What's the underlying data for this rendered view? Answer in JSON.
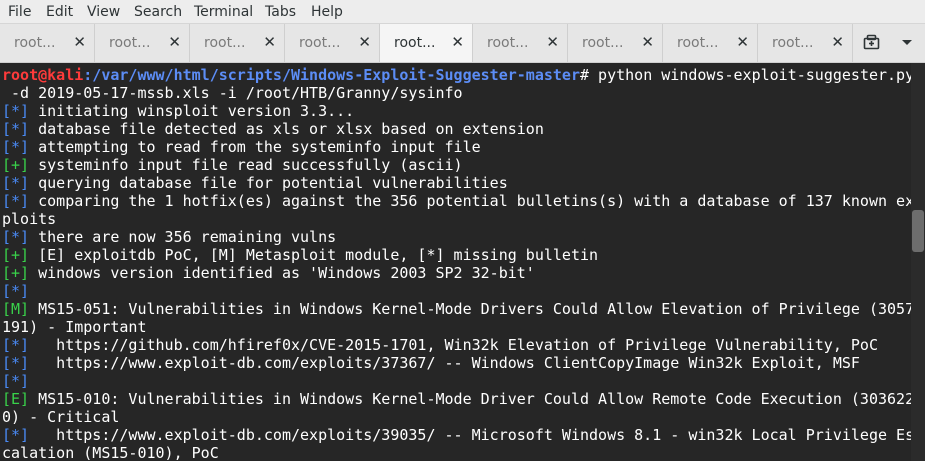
{
  "menu": [
    "File",
    "Edit",
    "View",
    "Search",
    "Terminal",
    "Tabs",
    "Help"
  ],
  "tabs": [
    {
      "label": "root...",
      "active": false
    },
    {
      "label": "root...",
      "active": false
    },
    {
      "label": "root...",
      "active": false
    },
    {
      "label": "root...",
      "active": false
    },
    {
      "label": "root...",
      "active": true
    },
    {
      "label": "root...",
      "active": false
    },
    {
      "label": "root...",
      "active": false
    },
    {
      "label": "root...",
      "active": false
    },
    {
      "label": "root...",
      "active": false
    }
  ],
  "colors": {
    "prompt": "#ff3b3b",
    "path": "#5c8df6",
    "info": "#4a8af4",
    "success": "#39d24a",
    "background": "#262626"
  },
  "icons": {
    "tab_close": "close-icon",
    "new_tab": "new-tab-icon",
    "menu": "chevron-down-icon"
  },
  "terminal": {
    "prompt_user": "root@kali",
    "prompt_path": ":/var/www/html/scripts/Windows-Exploit-Suggester-master",
    "prompt_symbol": "#",
    "command": " python windows-exploit-suggester.py",
    "lines": [
      {
        "tag": "",
        "text": " -d 2019-05-17-mssb.xls -i /root/HTB/Granny/sysinfo"
      },
      {
        "tag": "[*]",
        "text": " initiating winsploit version 3.3..."
      },
      {
        "tag": "[*]",
        "text": " database file detected as xls or xlsx based on extension"
      },
      {
        "tag": "[*]",
        "text": " attempting to read from the systeminfo input file"
      },
      {
        "tag": "[+]",
        "text": " systeminfo input file read successfully (ascii)"
      },
      {
        "tag": "[*]",
        "text": " querying database file for potential vulnerabilities"
      },
      {
        "tag": "[*]",
        "text": " comparing the 1 hotfix(es) against the 356 potential bulletins(s) with a database of 137 known ex"
      },
      {
        "tag": "",
        "text": "ploits"
      },
      {
        "tag": "[*]",
        "text": " there are now 356 remaining vulns"
      },
      {
        "tag": "[+]",
        "text": " [E] exploitdb PoC, [M] Metasploit module, [*] missing bulletin"
      },
      {
        "tag": "[+]",
        "text": " windows version identified as 'Windows 2003 SP2 32-bit'"
      },
      {
        "tag": "[*]",
        "text": ""
      },
      {
        "tag": "[M]",
        "text": " MS15-051: Vulnerabilities in Windows Kernel-Mode Drivers Could Allow Elevation of Privilege (3057"
      },
      {
        "tag": "",
        "text": "191) - Important"
      },
      {
        "tag": "[*]",
        "text": "   https://github.com/hfiref0x/CVE-2015-1701, Win32k Elevation of Privilege Vulnerability, PoC"
      },
      {
        "tag": "[*]",
        "text": "   https://www.exploit-db.com/exploits/37367/ -- Windows ClientCopyImage Win32k Exploit, MSF"
      },
      {
        "tag": "[*]",
        "text": ""
      },
      {
        "tag": "[E]",
        "text": " MS15-010: Vulnerabilities in Windows Kernel-Mode Driver Could Allow Remote Code Execution (303622"
      },
      {
        "tag": "",
        "text": "0) - Critical"
      },
      {
        "tag": "[*]",
        "text": "   https://www.exploit-db.com/exploits/39035/ -- Microsoft Windows 8.1 - win32k Local Privilege Es"
      },
      {
        "tag": "",
        "text": "calation (MS15-010), PoC"
      }
    ]
  }
}
